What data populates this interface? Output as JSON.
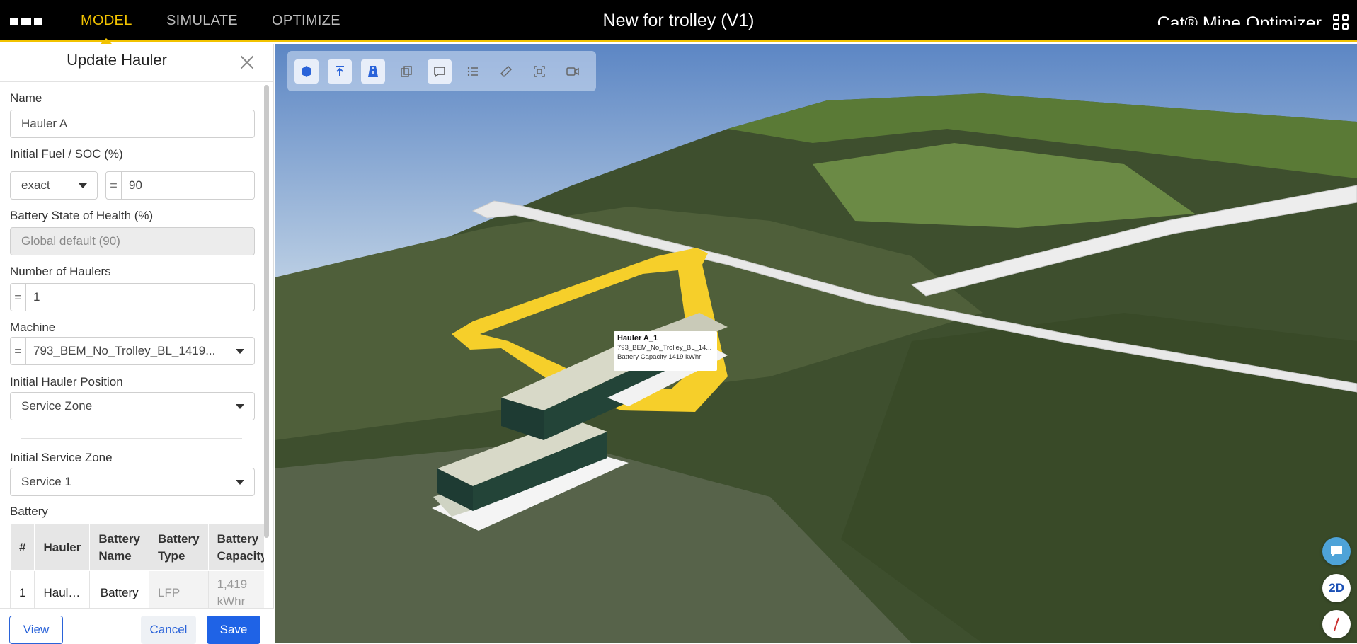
{
  "app": {
    "nav": [
      {
        "label": "MODEL",
        "active": true
      },
      {
        "label": "SIMULATE",
        "active": false
      },
      {
        "label": "OPTIMIZE",
        "active": false
      }
    ],
    "title": "New for trolley (V1)",
    "brand": "Cat® Mine Optimizer",
    "accent_color": "#f2c300"
  },
  "panel": {
    "title": "Update Hauler",
    "name_label": "Name",
    "name_value": "Hauler A",
    "fuel_label": "Initial Fuel / SOC (%)",
    "fuel_mode": "exact",
    "fuel_value": "90",
    "health_label": "Battery State of Health (%)",
    "health_value": "Global default (90)",
    "count_label": "Number of Haulers",
    "count_value": "1",
    "machine_label": "Machine",
    "machine_value": "793_BEM_No_Trolley_BL_1419...",
    "position_label": "Initial Hauler Position",
    "position_value": "Service Zone",
    "service_label": "Initial Service Zone",
    "service_value": "Service 1",
    "battery_label": "Battery",
    "battery_table": {
      "headers": [
        "#",
        "Hauler",
        "Battery Name",
        "Battery Type",
        "Battery Capacity"
      ],
      "rows": [
        [
          "1",
          "Haul…",
          "Battery",
          "LFP",
          "1,419 kWhr"
        ]
      ]
    },
    "buttons": {
      "view": "View",
      "cancel": "Cancel",
      "save": "Save"
    }
  },
  "map": {
    "tooltip": {
      "title": "Hauler A_1",
      "machine": "793_BEM_No_Trolley_BL_14...",
      "capacity": "Battery Capacity 1419 kWhr"
    },
    "toolbar_icons": [
      "cube-icon",
      "arrow-up-icon",
      "road-icon",
      "layers-icon",
      "comment-icon",
      "list-icon",
      "ruler-icon",
      "frame-icon",
      "camera-icon"
    ],
    "view_toggle": "2D",
    "route_color": "#f6cf2a"
  }
}
